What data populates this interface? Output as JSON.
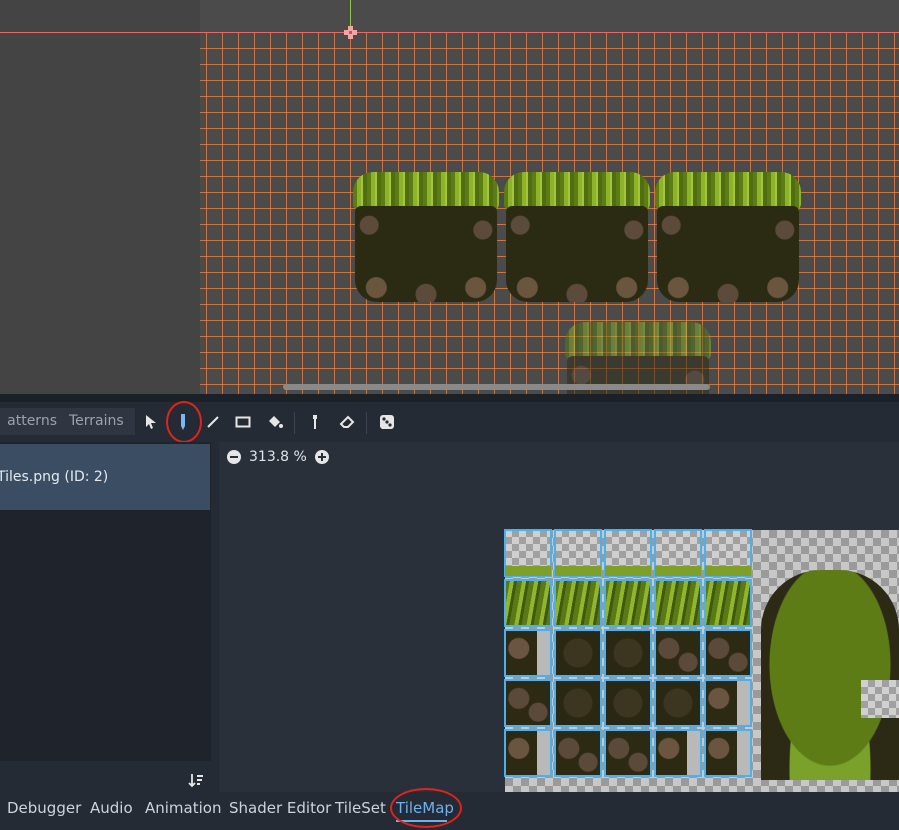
{
  "tile_panel": {
    "tabs": {
      "patterns": "atterns",
      "terrains": "Terrains"
    },
    "tools": {
      "select": "select-arrow-icon",
      "paint": "pencil-icon",
      "line": "line-icon",
      "rect": "rectangle-icon",
      "bucket": "bucket-icon",
      "picker": "picker-icon",
      "eraser": "eraser-icon",
      "random": "dice-icon"
    },
    "source_item": "Tiles.png (ID: 2)",
    "zoom": "313.8 %"
  },
  "bottom_tabs": [
    {
      "label": "Debugger"
    },
    {
      "label": "Audio"
    },
    {
      "label": "Animation"
    },
    {
      "label": "Shader Editor"
    },
    {
      "label": "TileSet"
    },
    {
      "label": "TileMap"
    }
  ],
  "colors": {
    "accent": "#6fb1ec",
    "annotation": "#e0241a",
    "grid": "#ea8246",
    "tile_outline": "#4ab0f0"
  }
}
